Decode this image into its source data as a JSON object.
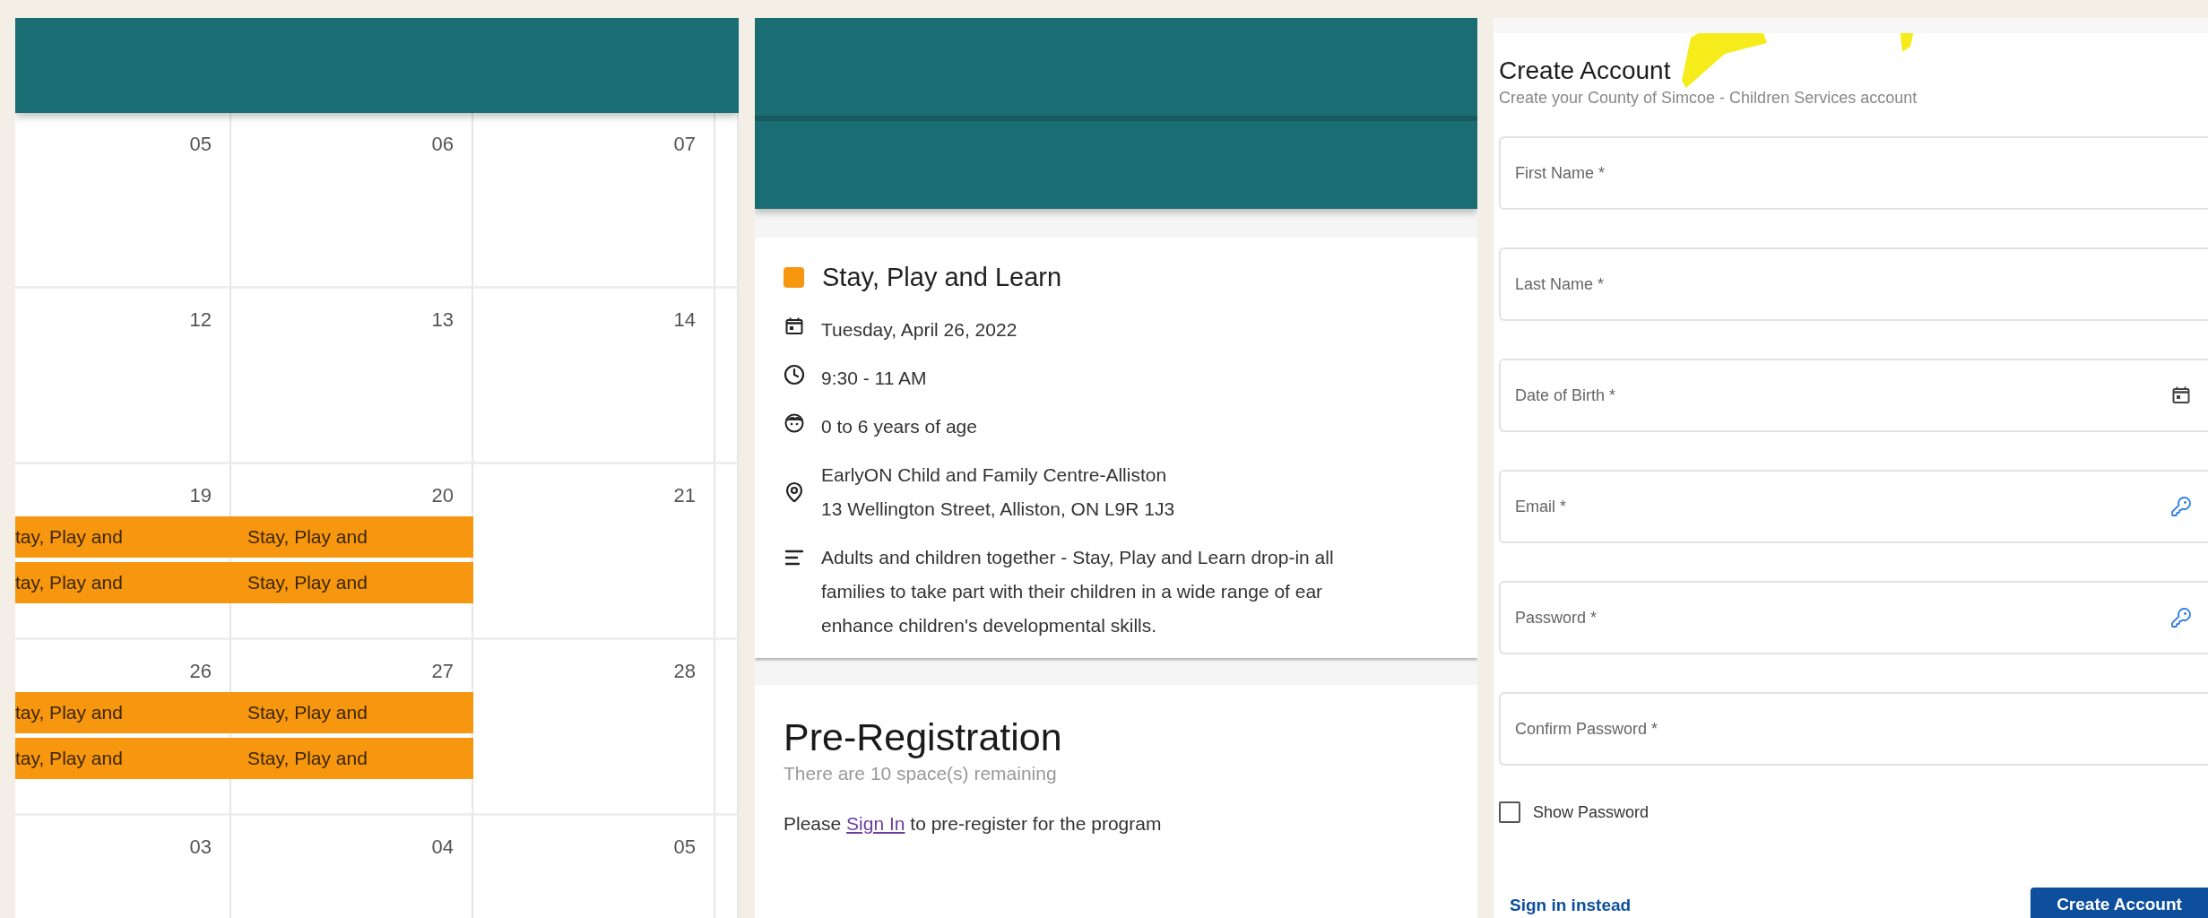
{
  "calendar": {
    "weeks": [
      {
        "days": [
          {
            "number": "05"
          },
          {
            "number": "06"
          },
          {
            "number": "07"
          }
        ]
      },
      {
        "days": [
          {
            "number": "12"
          },
          {
            "number": "13"
          },
          {
            "number": "14"
          }
        ]
      },
      {
        "days": [
          {
            "number": "19",
            "events": [
              "tay, Play and",
              "tay, Play and"
            ]
          },
          {
            "number": "20",
            "events": [
              "Stay, Play and",
              "Stay, Play and"
            ]
          },
          {
            "number": "21"
          }
        ]
      },
      {
        "days": [
          {
            "number": "26",
            "events": [
              "tay, Play and",
              "tay, Play and"
            ]
          },
          {
            "number": "27",
            "events": [
              "Stay, Play and",
              "Stay, Play and"
            ]
          },
          {
            "number": "28"
          }
        ]
      },
      {
        "days": [
          {
            "number": "03"
          },
          {
            "number": "04"
          },
          {
            "number": "05"
          }
        ]
      }
    ]
  },
  "event_detail": {
    "title": "Stay, Play and Learn",
    "details": [
      {
        "kind": "date",
        "lines": [
          "Tuesday, April 26, 2022"
        ]
      },
      {
        "kind": "time",
        "lines": [
          "9:30 - 11 AM"
        ]
      },
      {
        "kind": "age",
        "lines": [
          "0 to 6 years of age"
        ]
      },
      {
        "kind": "location",
        "lines": [
          "EarlyON Child and Family Centre-Alliston",
          "13 Wellington Street, Alliston, ON L9R 1J3"
        ]
      },
      {
        "kind": "description",
        "lines": [
          "Adults and children together - Stay, Play and Learn drop-in all",
          "families to take part with their children in a wide range of ear",
          "enhance children's developmental skills."
        ]
      }
    ]
  },
  "pre_registration": {
    "title": "Pre-Registration",
    "remaining": "There are 10 space(s) remaining",
    "prompt_before": "Please",
    "link": "Sign In",
    "prompt_after": "to pre-register for the program"
  },
  "create_account": {
    "title": "Create Account",
    "subtitle": "Create your County of Simcoe - Children Services account",
    "fields": [
      {
        "kind": "text",
        "placeholder": "First Name *"
      },
      {
        "kind": "text",
        "placeholder": "Last Name *"
      },
      {
        "kind": "date",
        "placeholder": "Date of Birth *"
      },
      {
        "kind": "key",
        "placeholder": "Email *"
      },
      {
        "kind": "key",
        "placeholder": "Password *"
      },
      {
        "kind": "text",
        "placeholder": "Confirm Password *"
      }
    ],
    "show_password": {
      "label": "Show Password",
      "checked": false
    },
    "sign_in_link": "Sign in instead",
    "submit": "Create Account"
  }
}
